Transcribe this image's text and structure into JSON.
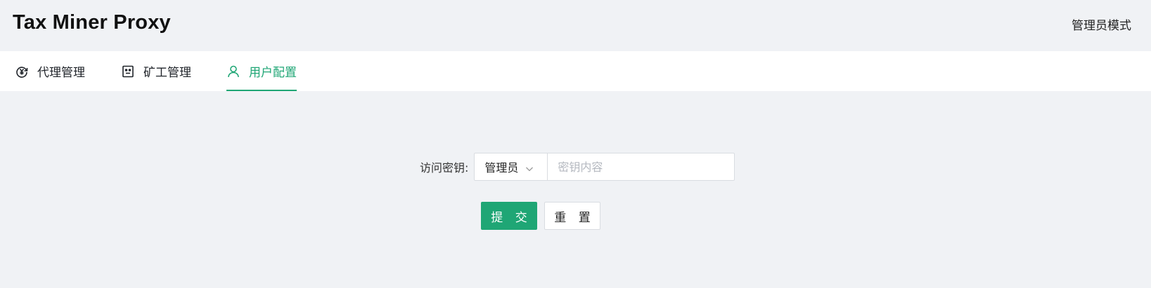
{
  "header": {
    "title": "Tax Miner Proxy",
    "mode_link": "管理员模式"
  },
  "tabs": [
    {
      "label": "代理管理",
      "icon": "proxy-icon",
      "active": false
    },
    {
      "label": "矿工管理",
      "icon": "miner-icon",
      "active": false
    },
    {
      "label": "用户配置",
      "icon": "user-icon",
      "active": true
    }
  ],
  "form": {
    "access_key_label": "访问密钥:",
    "role_select_value": "管理员",
    "key_placeholder": "密钥内容",
    "key_value": "",
    "submit_label": "提 交",
    "reset_label": "重 置"
  },
  "colors": {
    "accent": "#1fa675",
    "background": "#f0f2f5"
  }
}
